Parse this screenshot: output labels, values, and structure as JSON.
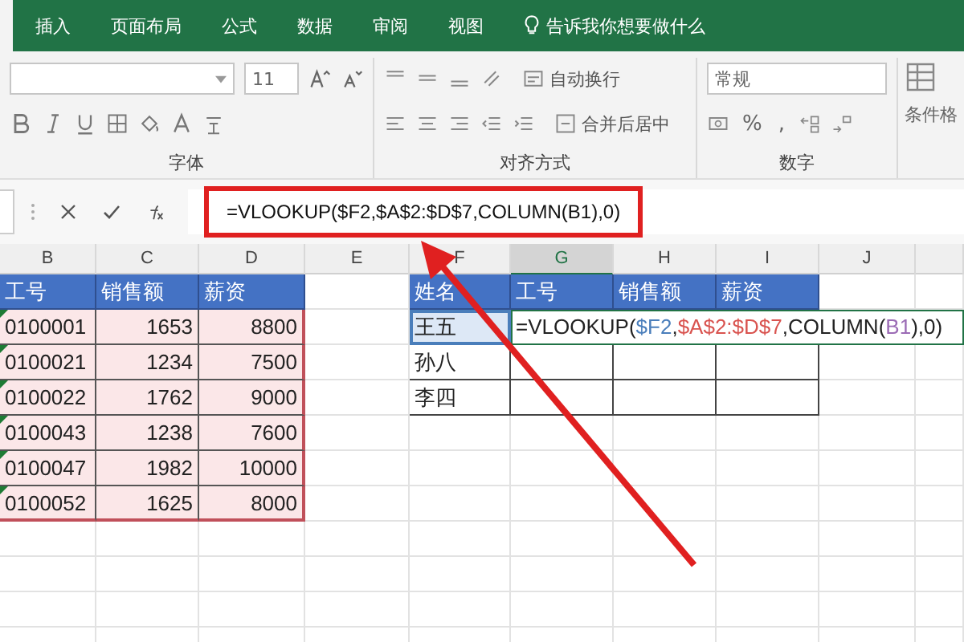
{
  "ribbon_tabs": [
    {
      "label": "插入"
    },
    {
      "label": "页面布局"
    },
    {
      "label": "公式"
    },
    {
      "label": "数据"
    },
    {
      "label": "审阅"
    },
    {
      "label": "视图"
    }
  ],
  "tell_me": "告诉我你想要做什么",
  "font_group": {
    "label": "字体",
    "font_size": "11"
  },
  "alignment_group": {
    "label": "对齐方式",
    "wrap_text": "自动换行",
    "merge_center": "合并后居中"
  },
  "number_group": {
    "label": "数字",
    "format": "常规",
    "percent": "%",
    "comma": ","
  },
  "conditional_format": "条件格",
  "formula_bar": {
    "formula": "=VLOOKUP($F2,$A$2:$D$7,COLUMN(B1),0)"
  },
  "columns": [
    {
      "label": "B",
      "selected": false
    },
    {
      "label": "C",
      "selected": false
    },
    {
      "label": "D",
      "selected": false
    },
    {
      "label": "E",
      "selected": false
    },
    {
      "label": "F",
      "selected": false
    },
    {
      "label": "G",
      "selected": true
    },
    {
      "label": "H",
      "selected": false
    },
    {
      "label": "I",
      "selected": false
    },
    {
      "label": "J",
      "selected": false
    }
  ],
  "lookup_table": {
    "headers": [
      "工号",
      "销售额",
      "薪资"
    ],
    "rows": [
      [
        "0100001",
        "1653",
        "8800"
      ],
      [
        "0100021",
        "1234",
        "7500"
      ],
      [
        "0100022",
        "1762",
        "9000"
      ],
      [
        "0100043",
        "1238",
        "7600"
      ],
      [
        "0100047",
        "1982",
        "10000"
      ],
      [
        "0100052",
        "1625",
        "8000"
      ]
    ]
  },
  "result_table": {
    "headers": [
      "姓名",
      "工号",
      "销售额",
      "薪资"
    ],
    "names": [
      "王五",
      "孙八",
      "李四"
    ]
  },
  "cell_formula": [
    {
      "text": "=VLOOKUP("
    },
    {
      "text": "$F2",
      "color": "#4a7ebb"
    },
    {
      "text": ","
    },
    {
      "text": "$A$2:$D$7",
      "color": "#d9534f"
    },
    {
      "text": ",COLUMN("
    },
    {
      "text": "B1",
      "color": "#9b6bb5"
    },
    {
      "text": "),0)"
    }
  ]
}
